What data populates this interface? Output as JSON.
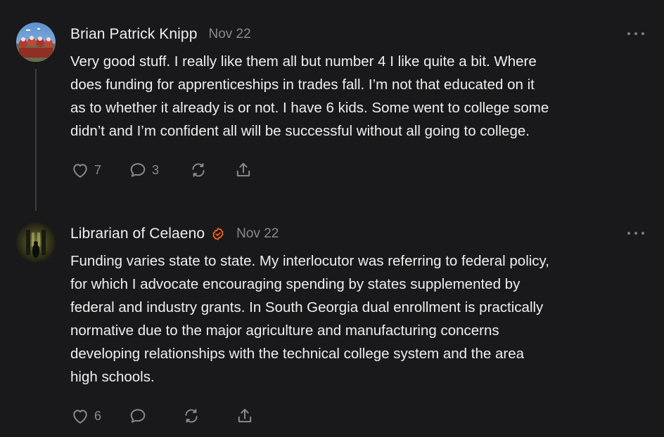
{
  "comments": [
    {
      "author": "Brian Patrick Knipp",
      "date": "Nov 22",
      "verified": false,
      "text": "Very good stuff. I really like them all but number 4 I like quite a bit. Where\ndoes funding for apprenticeships in trades fall. I’m not that educated on it\nas to whether it already is or not. I have 6 kids. Some went to college some\ndidn’t and I’m confident all will be successful without all going to college.",
      "likes": "7",
      "replies": "3"
    },
    {
      "author": "Librarian of Celaeno",
      "date": "Nov 22",
      "verified": true,
      "text": "Funding varies state to state. My interlocutor was referring to federal policy,\nfor which I advocate encouraging spending by states supplemented by\nfederal and industry grants. In South Georgia dual enrollment is practically\nnormative due to the major agriculture and manufacturing concerns\ndeveloping relationships with the technical college system and the area\nhigh schools.",
      "likes": "6",
      "replies": ""
    }
  ],
  "icons": {
    "like": "heart-icon",
    "reply": "speech-bubble-icon",
    "restack": "restack-arrows-icon",
    "share": "share-upload-icon",
    "more": "ellipsis-icon",
    "verified": "verified-badge-icon"
  },
  "colors": {
    "background": "#19191b",
    "text": "#efefef",
    "muted": "#8a8a8e",
    "accent": "#ff6719"
  }
}
